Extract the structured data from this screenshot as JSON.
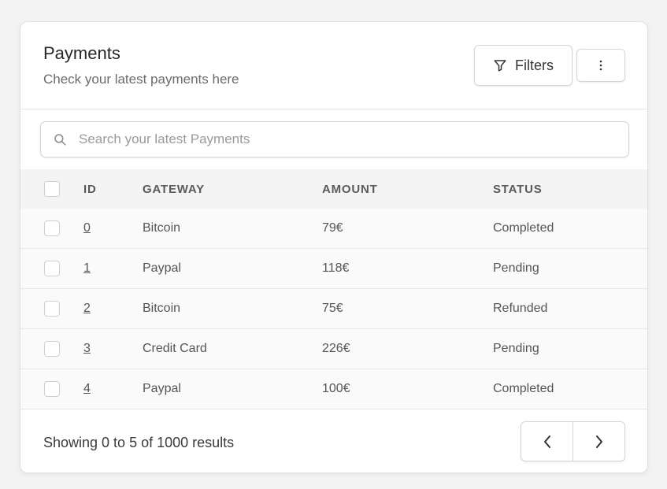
{
  "header": {
    "title": "Payments",
    "subtitle": "Check your latest payments here",
    "filters_label": "Filters"
  },
  "search": {
    "placeholder": "Search your latest Payments"
  },
  "table": {
    "columns": [
      "ID",
      "GATEWAY",
      "AMOUNT",
      "STATUS"
    ],
    "rows": [
      {
        "id": "0",
        "gateway": "Bitcoin",
        "amount": "79€",
        "status": "Completed"
      },
      {
        "id": "1",
        "gateway": "Paypal",
        "amount": "118€",
        "status": "Pending"
      },
      {
        "id": "2",
        "gateway": "Bitcoin",
        "amount": "75€",
        "status": "Refunded"
      },
      {
        "id": "3",
        "gateway": "Credit Card",
        "amount": "226€",
        "status": "Pending"
      },
      {
        "id": "4",
        "gateway": "Paypal",
        "amount": "100€",
        "status": "Completed"
      }
    ]
  },
  "footer": {
    "results_text": "Showing 0 to 5 of 1000 results"
  },
  "icons": {
    "filter": "filter-icon",
    "more": "more-vertical-icon",
    "search": "search-icon",
    "prev": "chevron-left-icon",
    "next": "chevron-right-icon"
  }
}
